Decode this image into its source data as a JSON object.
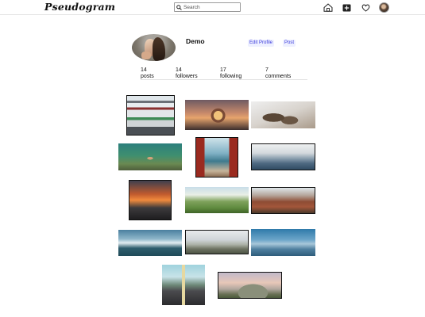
{
  "navbar": {
    "logo": "Pseudogram",
    "search": {
      "placeholder": "Search",
      "value": ""
    },
    "icons": [
      "home-icon",
      "add-post-icon",
      "heart-icon",
      "profile-avatar"
    ]
  },
  "profile": {
    "username": "Demo",
    "edit_profile_label": "Edit Profile",
    "post_label": "Post",
    "stats": [
      {
        "value": "14",
        "label": "posts"
      },
      {
        "value": "14",
        "label": "followers"
      },
      {
        "value": "17",
        "label": "following"
      },
      {
        "value": "7",
        "label": "comments"
      }
    ]
  },
  "colors": {
    "accent": "#3a3adc",
    "pill_bg": "#eef0ff",
    "divider": "#e3e3e3"
  },
  "gallery": [
    "building-photo",
    "crystal-ball-sunset-photo",
    "seals-on-rocks-photo",
    "underwater-fish-photo",
    "red-doors-lake-photo",
    "blue-mountains-mist-photo",
    "orange-sunset-mountains-photo",
    "green-valley-sky-photo",
    "red-canyon-photo",
    "turquoise-lake-mountains-photo",
    "snowy-hills-photo",
    "blue-hazy-hills-photo",
    "road-mountains-photo",
    "hill-sunset-sky-photo"
  ]
}
